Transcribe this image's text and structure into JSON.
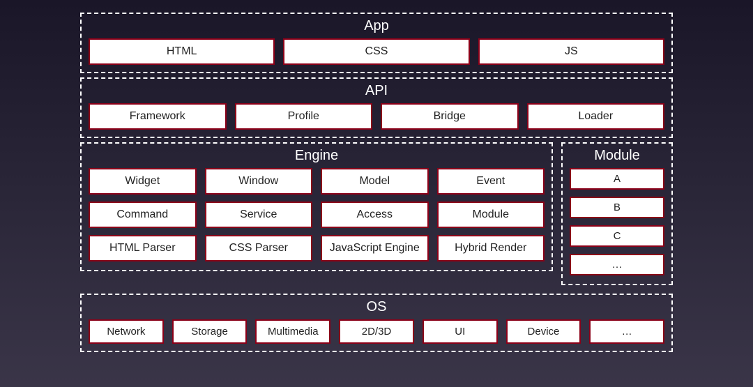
{
  "app": {
    "title": "App",
    "items": [
      "HTML",
      "CSS",
      "JS"
    ]
  },
  "api": {
    "title": "API",
    "items": [
      "Framework",
      "Profile",
      "Bridge",
      "Loader"
    ]
  },
  "engine": {
    "title": "Engine",
    "rows": [
      [
        "Widget",
        "Window",
        "Model",
        "Event"
      ],
      [
        "Command",
        "Service",
        "Access",
        "Module"
      ],
      [
        "HTML Parser",
        "CSS Parser",
        "JavaScript Engine",
        "Hybrid Render"
      ]
    ]
  },
  "module": {
    "title": "Module",
    "items": [
      "A",
      "B",
      "C",
      "…"
    ]
  },
  "os": {
    "title": "OS",
    "items": [
      "Network",
      "Storage",
      "Multimedia",
      "2D/3D",
      "UI",
      "Device",
      "…"
    ]
  }
}
